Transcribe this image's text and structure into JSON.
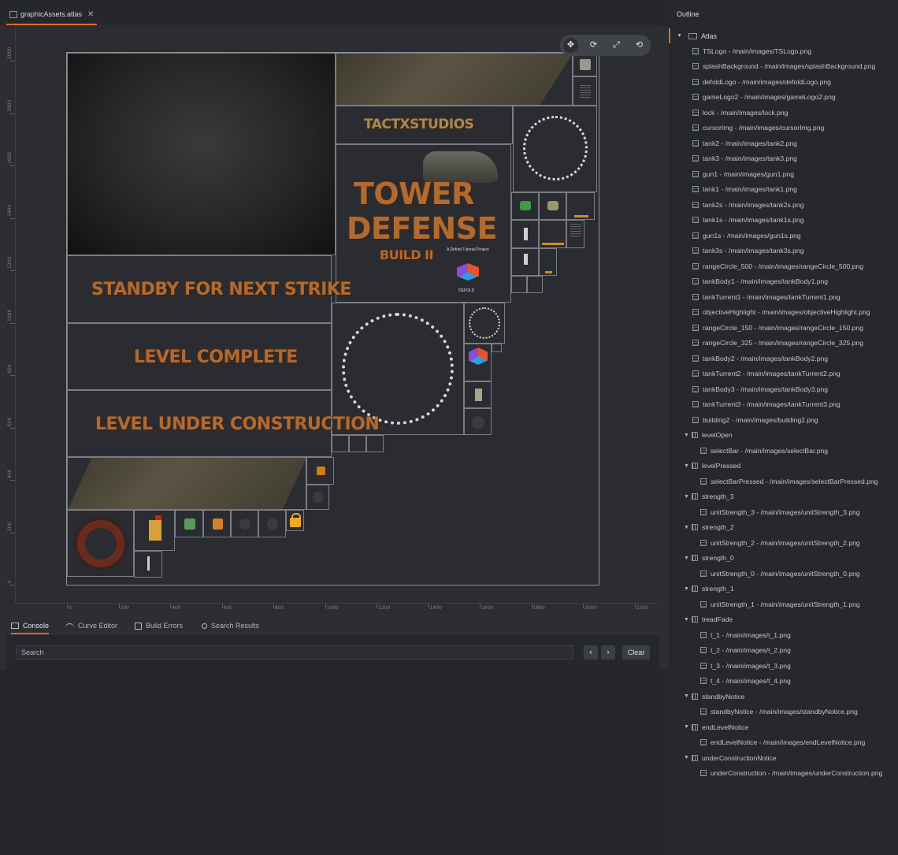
{
  "editor": {
    "tab_title": "graphicAssets.atlas",
    "tab_close": "✕"
  },
  "ruler": {
    "x_labels": [
      "0",
      "200",
      "400",
      "600",
      "800",
      "1000",
      "1200",
      "1400",
      "1600",
      "1800",
      "2000",
      "2200"
    ],
    "y_labels": [
      "2000",
      "1800",
      "1600",
      "1400",
      "1200",
      "1000",
      "800",
      "600",
      "400",
      "200",
      "0"
    ]
  },
  "atlas": {
    "tactx_logo_text": "TACTXSTUDIOS",
    "splash_title_line1": "TOWER",
    "splash_title_line2": "DEFENSE",
    "splash_build": "BUILD II",
    "splash_tagline": "A Defold Tutorial Project",
    "splash_defold": "DEFOLD",
    "standby_text": "STANDBY FOR NEXT STRIKE",
    "level_complete_text": "LEVEL COMPLETE",
    "under_construction_text": "LEVEL UNDER CONSTRUCTION"
  },
  "toolbar": {
    "move_icon": "move-icon",
    "rotate_icon": "rotate-icon",
    "scale_icon": "scale-icon",
    "reset_icon": "reset-icon"
  },
  "bottom_tabs": [
    {
      "label": "Console",
      "icon": "terminal-icon"
    },
    {
      "label": "Curve Editor",
      "icon": "curve-icon"
    },
    {
      "label": "Build Errors",
      "icon": "error-icon"
    },
    {
      "label": "Search Results",
      "icon": "search-icon"
    }
  ],
  "console": {
    "search_placeholder": "Search",
    "prev_label": "‹",
    "next_label": "›",
    "clear_label": "Clear"
  },
  "outline": {
    "title": "Outline",
    "root": "Atlas",
    "items": [
      {
        "label": "TSLogo - /main/images/TSLogo.png",
        "level": 1,
        "type": "image"
      },
      {
        "label": "splashBackground - /main/images/splashBackground.png",
        "level": 1,
        "type": "image"
      },
      {
        "label": "defoldLogo - /main/images/defoldLogo.png",
        "level": 1,
        "type": "image"
      },
      {
        "label": "gameLogo2 - /main/images/gameLogo2.png",
        "level": 1,
        "type": "image"
      },
      {
        "label": "lock - /main/images/lock.png",
        "level": 1,
        "type": "image"
      },
      {
        "label": "cursorImg - /main/images/cursorImg.png",
        "level": 1,
        "type": "image"
      },
      {
        "label": "tank2 - /main/images/tank2.png",
        "level": 1,
        "type": "image"
      },
      {
        "label": "tank3 - /main/images/tank3.png",
        "level": 1,
        "type": "image"
      },
      {
        "label": "gun1 - /main/images/gun1.png",
        "level": 1,
        "type": "image"
      },
      {
        "label": "tank1 - /main/images/tank1.png",
        "level": 1,
        "type": "image"
      },
      {
        "label": "tank2s - /main/images/tank2s.png",
        "level": 1,
        "type": "image"
      },
      {
        "label": "tank1s - /main/images/tank1s.png",
        "level": 1,
        "type": "image"
      },
      {
        "label": "gun1s - /main/images/gun1s.png",
        "level": 1,
        "type": "image"
      },
      {
        "label": "tank3s - /main/images/tank3s.png",
        "level": 1,
        "type": "image"
      },
      {
        "label": "rangeCircle_500 - /main/images/rangeCircle_500.png",
        "level": 1,
        "type": "image"
      },
      {
        "label": "tankBody1 - /main/images/tankBody1.png",
        "level": 1,
        "type": "image"
      },
      {
        "label": "tankTurrent1 - /main/images/tankTurrent1.png",
        "level": 1,
        "type": "image"
      },
      {
        "label": "objectiveHighlight - /main/images/objectiveHighlight.png",
        "level": 1,
        "type": "image"
      },
      {
        "label": "rangeCircle_150 - /main/images/rangeCircle_150.png",
        "level": 1,
        "type": "image"
      },
      {
        "label": "rangeCircle_325 - /main/images/rangeCircle_325.png",
        "level": 1,
        "type": "image"
      },
      {
        "label": "tankBody2 - /main/images/tankBody2.png",
        "level": 1,
        "type": "image"
      },
      {
        "label": "tankTurrent2 - /main/images/tankTurrent2.png",
        "level": 1,
        "type": "image"
      },
      {
        "label": "tankBody3 - /main/images/tankBody3.png",
        "level": 1,
        "type": "image"
      },
      {
        "label": "tankTurrent3 - /main/images/tankTurrent3.png",
        "level": 1,
        "type": "image"
      },
      {
        "label": "building2 - /main/images/building2.png",
        "level": 1,
        "type": "image"
      },
      {
        "label": "levelOpen",
        "level": 1,
        "type": "group"
      },
      {
        "label": "selectBar - /main/images/selectBar.png",
        "level": 2,
        "type": "image"
      },
      {
        "label": "levelPressed",
        "level": 1,
        "type": "group"
      },
      {
        "label": "selectBarPressed - /main/images/selectBarPressed.png",
        "level": 2,
        "type": "image"
      },
      {
        "label": "strength_3",
        "level": 1,
        "type": "group"
      },
      {
        "label": "unitStrength_3 - /main/images/unitStrength_3.png",
        "level": 2,
        "type": "image"
      },
      {
        "label": "strength_2",
        "level": 1,
        "type": "group"
      },
      {
        "label": "unitStrength_2 - /main/images/unitStrength_2.png",
        "level": 2,
        "type": "image"
      },
      {
        "label": "strength_0",
        "level": 1,
        "type": "group"
      },
      {
        "label": "unitStrength_0 - /main/images/unitStrength_0.png",
        "level": 2,
        "type": "image"
      },
      {
        "label": "strength_1",
        "level": 1,
        "type": "group"
      },
      {
        "label": "unitStrength_1 - /main/images/unitStrength_1.png",
        "level": 2,
        "type": "image"
      },
      {
        "label": "treadFade",
        "level": 1,
        "type": "group"
      },
      {
        "label": "t_1 - /main/images/t_1.png",
        "level": 2,
        "type": "image"
      },
      {
        "label": "t_2 - /main/images/t_2.png",
        "level": 2,
        "type": "image"
      },
      {
        "label": "t_3 - /main/images/t_3.png",
        "level": 2,
        "type": "image"
      },
      {
        "label": "t_4 - /main/images/t_4.png",
        "level": 2,
        "type": "image"
      },
      {
        "label": "standbyNotice",
        "level": 1,
        "type": "group"
      },
      {
        "label": "standbyNotice - /main/images/standbyNotice.png",
        "level": 2,
        "type": "image"
      },
      {
        "label": "endLevelNotice",
        "level": 1,
        "type": "group"
      },
      {
        "label": "endLevelNotice - /main/images/endLevelNotice.png",
        "level": 2,
        "type": "image"
      },
      {
        "label": "underConstructionNotice",
        "level": 1,
        "type": "group"
      },
      {
        "label": "underConstruction - /main/images/underConstruction.png",
        "level": 2,
        "type": "image"
      }
    ]
  }
}
